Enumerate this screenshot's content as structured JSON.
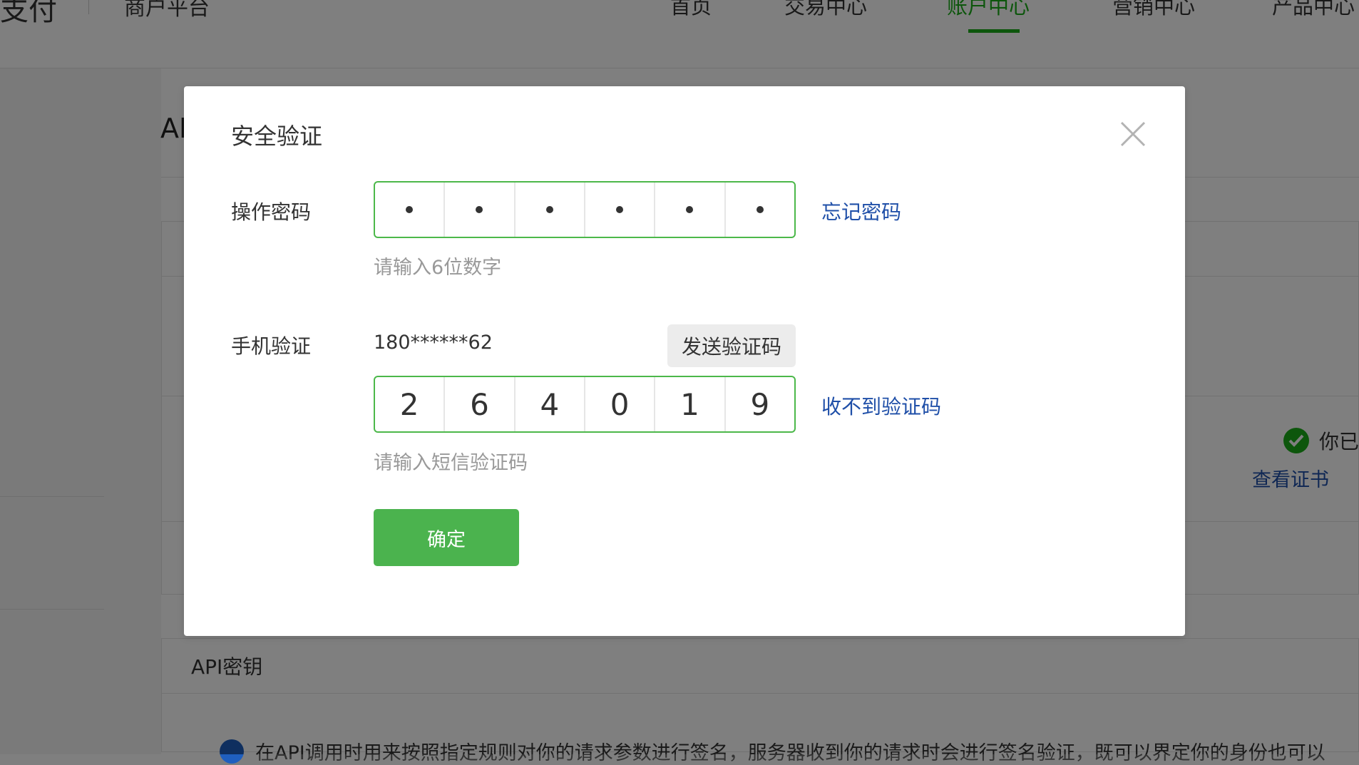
{
  "header": {
    "brand_fragment": "支付",
    "platform": "商户平台",
    "nav": [
      "首页",
      "交易中心",
      "账户中心",
      "营销中心",
      "产品中心"
    ]
  },
  "background": {
    "title_fragment": "AI",
    "api_section_title": "API密钥",
    "notice_text": "在API调用时用来按照指定规则对你的请求参数进行签名，服务器收到你的请求时会进行签名验证，既可以界定你的身份也可以",
    "cert_status": "你已",
    "view_cert": "查看证书"
  },
  "modal": {
    "title": "安全验证",
    "password": {
      "label": "操作密码",
      "cells": [
        "•",
        "•",
        "•",
        "•",
        "•",
        "•"
      ],
      "forgot": "忘记密码",
      "hint": "请输入6位数字"
    },
    "phone": {
      "label": "手机验证",
      "number": "180******62",
      "send_button": "发送验证码",
      "code": [
        "2",
        "6",
        "4",
        "0",
        "1",
        "9"
      ],
      "resend_link": "收不到验证码",
      "hint": "请输入短信验证码"
    },
    "confirm": "确定"
  },
  "colors": {
    "accent_green": "#1aad19",
    "input_border": "#4cb84a",
    "link_blue": "#1f4fa8",
    "button_green": "#4bb34e"
  }
}
